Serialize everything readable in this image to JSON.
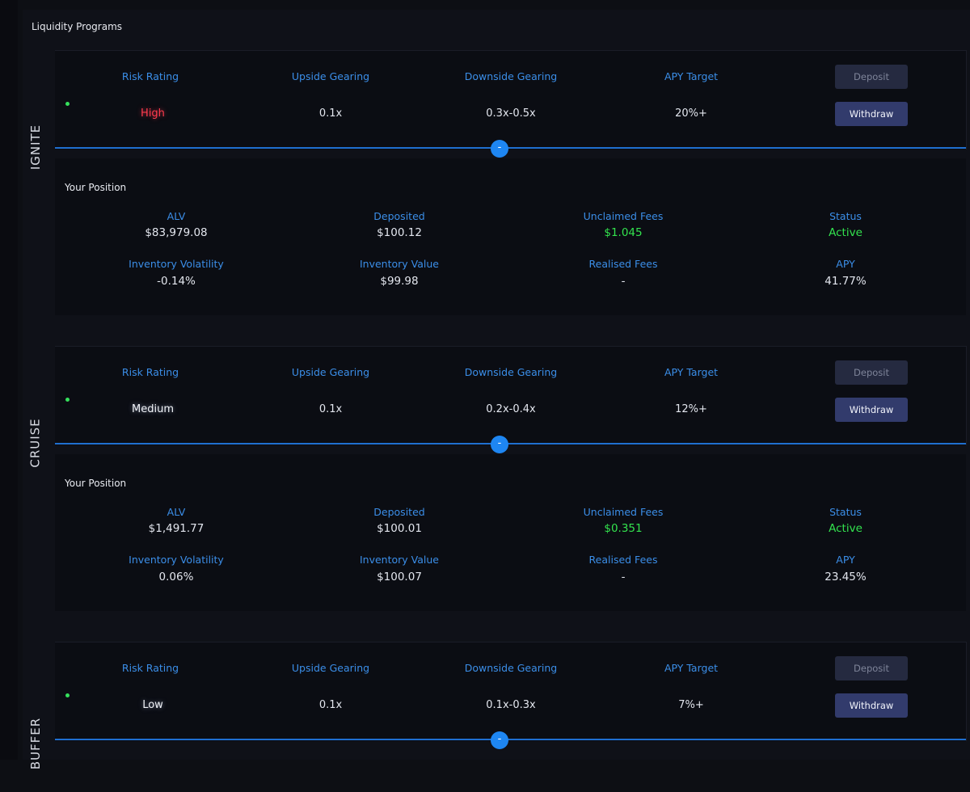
{
  "page_title": "Liquidity Programs",
  "column_headers": {
    "risk": "Risk Rating",
    "upside": "Upside Gearing",
    "downside": "Downside Gearing",
    "apy_target": "APY Target"
  },
  "buttons": {
    "deposit": "Deposit",
    "withdraw": "Withdraw"
  },
  "toggle_symbol": "-",
  "position_title": "Your Position",
  "metric_labels": {
    "alv": "ALV",
    "deposited": "Deposited",
    "unclaimed": "Unclaimed Fees",
    "status": "Status",
    "inv_vol": "Inventory Volatility",
    "inv_value": "Inventory Value",
    "realised": "Realised Fees",
    "apy": "APY"
  },
  "colors": {
    "accent": "#3b8ee8",
    "positive": "#33e34e",
    "high_risk": "#ff3b4e",
    "button": "#323b6c"
  },
  "programs": [
    {
      "name": "IGNITE",
      "risk": "High",
      "upside": "0.1x",
      "downside": "0.3x-0.5x",
      "apy_target": "20%+",
      "position": {
        "alv": "$83,979.08",
        "deposited": "$100.12",
        "unclaimed": "$1.045",
        "status": "Active",
        "inv_vol": "-0.14%",
        "inv_value": "$99.98",
        "realised": "-",
        "apy": "41.77%"
      }
    },
    {
      "name": "CRUISE",
      "risk": "Medium",
      "upside": "0.1x",
      "downside": "0.2x-0.4x",
      "apy_target": "12%+",
      "position": {
        "alv": "$1,491.77",
        "deposited": "$100.01",
        "unclaimed": "$0.351",
        "status": "Active",
        "inv_vol": "0.06%",
        "inv_value": "$100.07",
        "realised": "-",
        "apy": "23.45%"
      }
    },
    {
      "name": "BUFFER",
      "risk": "Low",
      "upside": "0.1x",
      "downside": "0.1x-0.3x",
      "apy_target": "7%+"
    }
  ]
}
